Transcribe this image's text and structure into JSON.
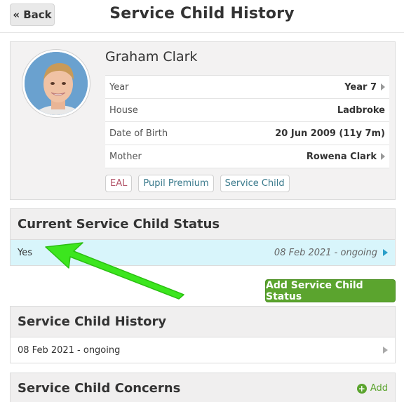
{
  "header": {
    "back_label": "« Back",
    "title": "Service Child History"
  },
  "profile": {
    "name": "Graham Clark",
    "rows": [
      {
        "label": "Year",
        "value": "Year 7"
      },
      {
        "label": "House",
        "value": "Ladbroke"
      },
      {
        "label": "Date of Birth",
        "value": "20 Jun 2009 (11y 7m)"
      },
      {
        "label": "Mother",
        "value": "Rowena Clark"
      }
    ],
    "tags": [
      "EAL",
      "Pupil Premium",
      "Service Child"
    ]
  },
  "current_status": {
    "title": "Current Service Child Status",
    "value": "Yes",
    "date": "08 Feb 2021 - ongoing"
  },
  "add_status_label": "Add Service Child Status",
  "history": {
    "title": "Service Child History",
    "entry": "08 Feb 2021 - ongoing"
  },
  "concerns": {
    "title": "Service Child Concerns",
    "add_label": "Add"
  },
  "colors": {
    "accent_green": "#5ba42e",
    "status_highlight": "#d8f5fb",
    "annotation_arrow": "#3ce61e"
  },
  "icons": {
    "back": "none",
    "row_chevron": "triangle-right-icon",
    "status_chevron": "triangle-right-blue-icon",
    "add": "plus-circle-icon"
  }
}
